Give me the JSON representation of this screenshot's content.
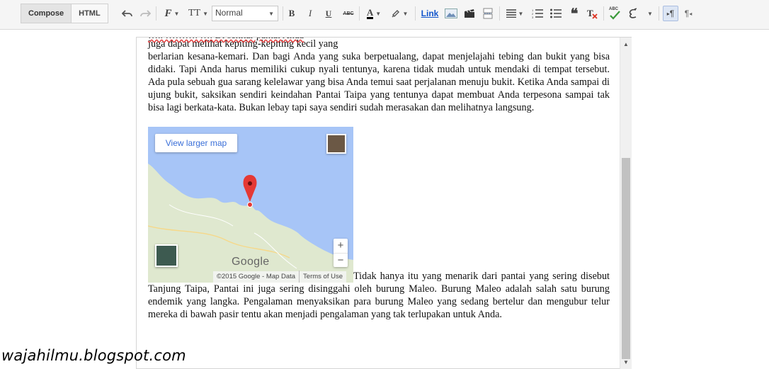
{
  "toolbar": {
    "compose_label": "Compose",
    "html_label": "HTML",
    "font_glyph": "F",
    "size_glyph": "TT",
    "format_value": "Normal",
    "bold_glyph": "B",
    "italic_glyph": "I",
    "underline_glyph": "U",
    "strike_glyph": "ABC",
    "textcolor_glyph": "A",
    "link_label": "Link",
    "quote_glyph": "❝",
    "spell_glyph": "ABC",
    "ltr_glyph": "¶",
    "rtl_glyph": "¶"
  },
  "editor": {
    "cut_line": "…..  ……….  ….  Di sekitar pantai Anda",
    "line1": "juga dapat melihat kepiting-kepiting kecil yang",
    "paragraph1": "berlarian kesana-kemari. Dan bagi Anda yang suka berpetualang, dapat menjelajahi tebing dan bukit yang bisa didaki. Tapi Anda harus memiliki cukup nyali tentunya, karena tidak mudah untuk mendaki di tempat tersebut. Ada pula sebuah gua sarang kelelawar yang bisa Anda temui saat perjalanan menuju bukit. Ketika Anda sampai di ujung bukit, saksikan sendiri keindahan Pantai Taipa yang tentunya dapat membuat Anda terpesona sampai tak bisa lagi berkata-kata. Bukan lebay tapi saya sendiri sudah merasakan dan melihatnya langsung.",
    "paragraph2": "Tidak hanya itu yang menarik dari pantai yang sering disebut Tanjung Taipa, Pantai ini juga sering disinggahi oleh burung Maleo. Burung Maleo adalah salah satu burung endemik yang langka. Pengalaman menyaksikan para burung Maleo yang sedang bertelur dan mengubur telur mereka di bawah pasir tentu akan menjadi pengalaman yang tak terlupakan untuk Anda."
  },
  "map": {
    "view_larger": "View larger map",
    "zoom_in": "+",
    "zoom_out": "−",
    "logo": "Google",
    "attribution": "©2015 Google - Map Data",
    "terms": "Terms of Use",
    "water_color": "#a7c5f7",
    "land_color": "#dfe8cf",
    "pin_color": "#e53935"
  },
  "watermark": "wajahilmu.blogspot.com"
}
